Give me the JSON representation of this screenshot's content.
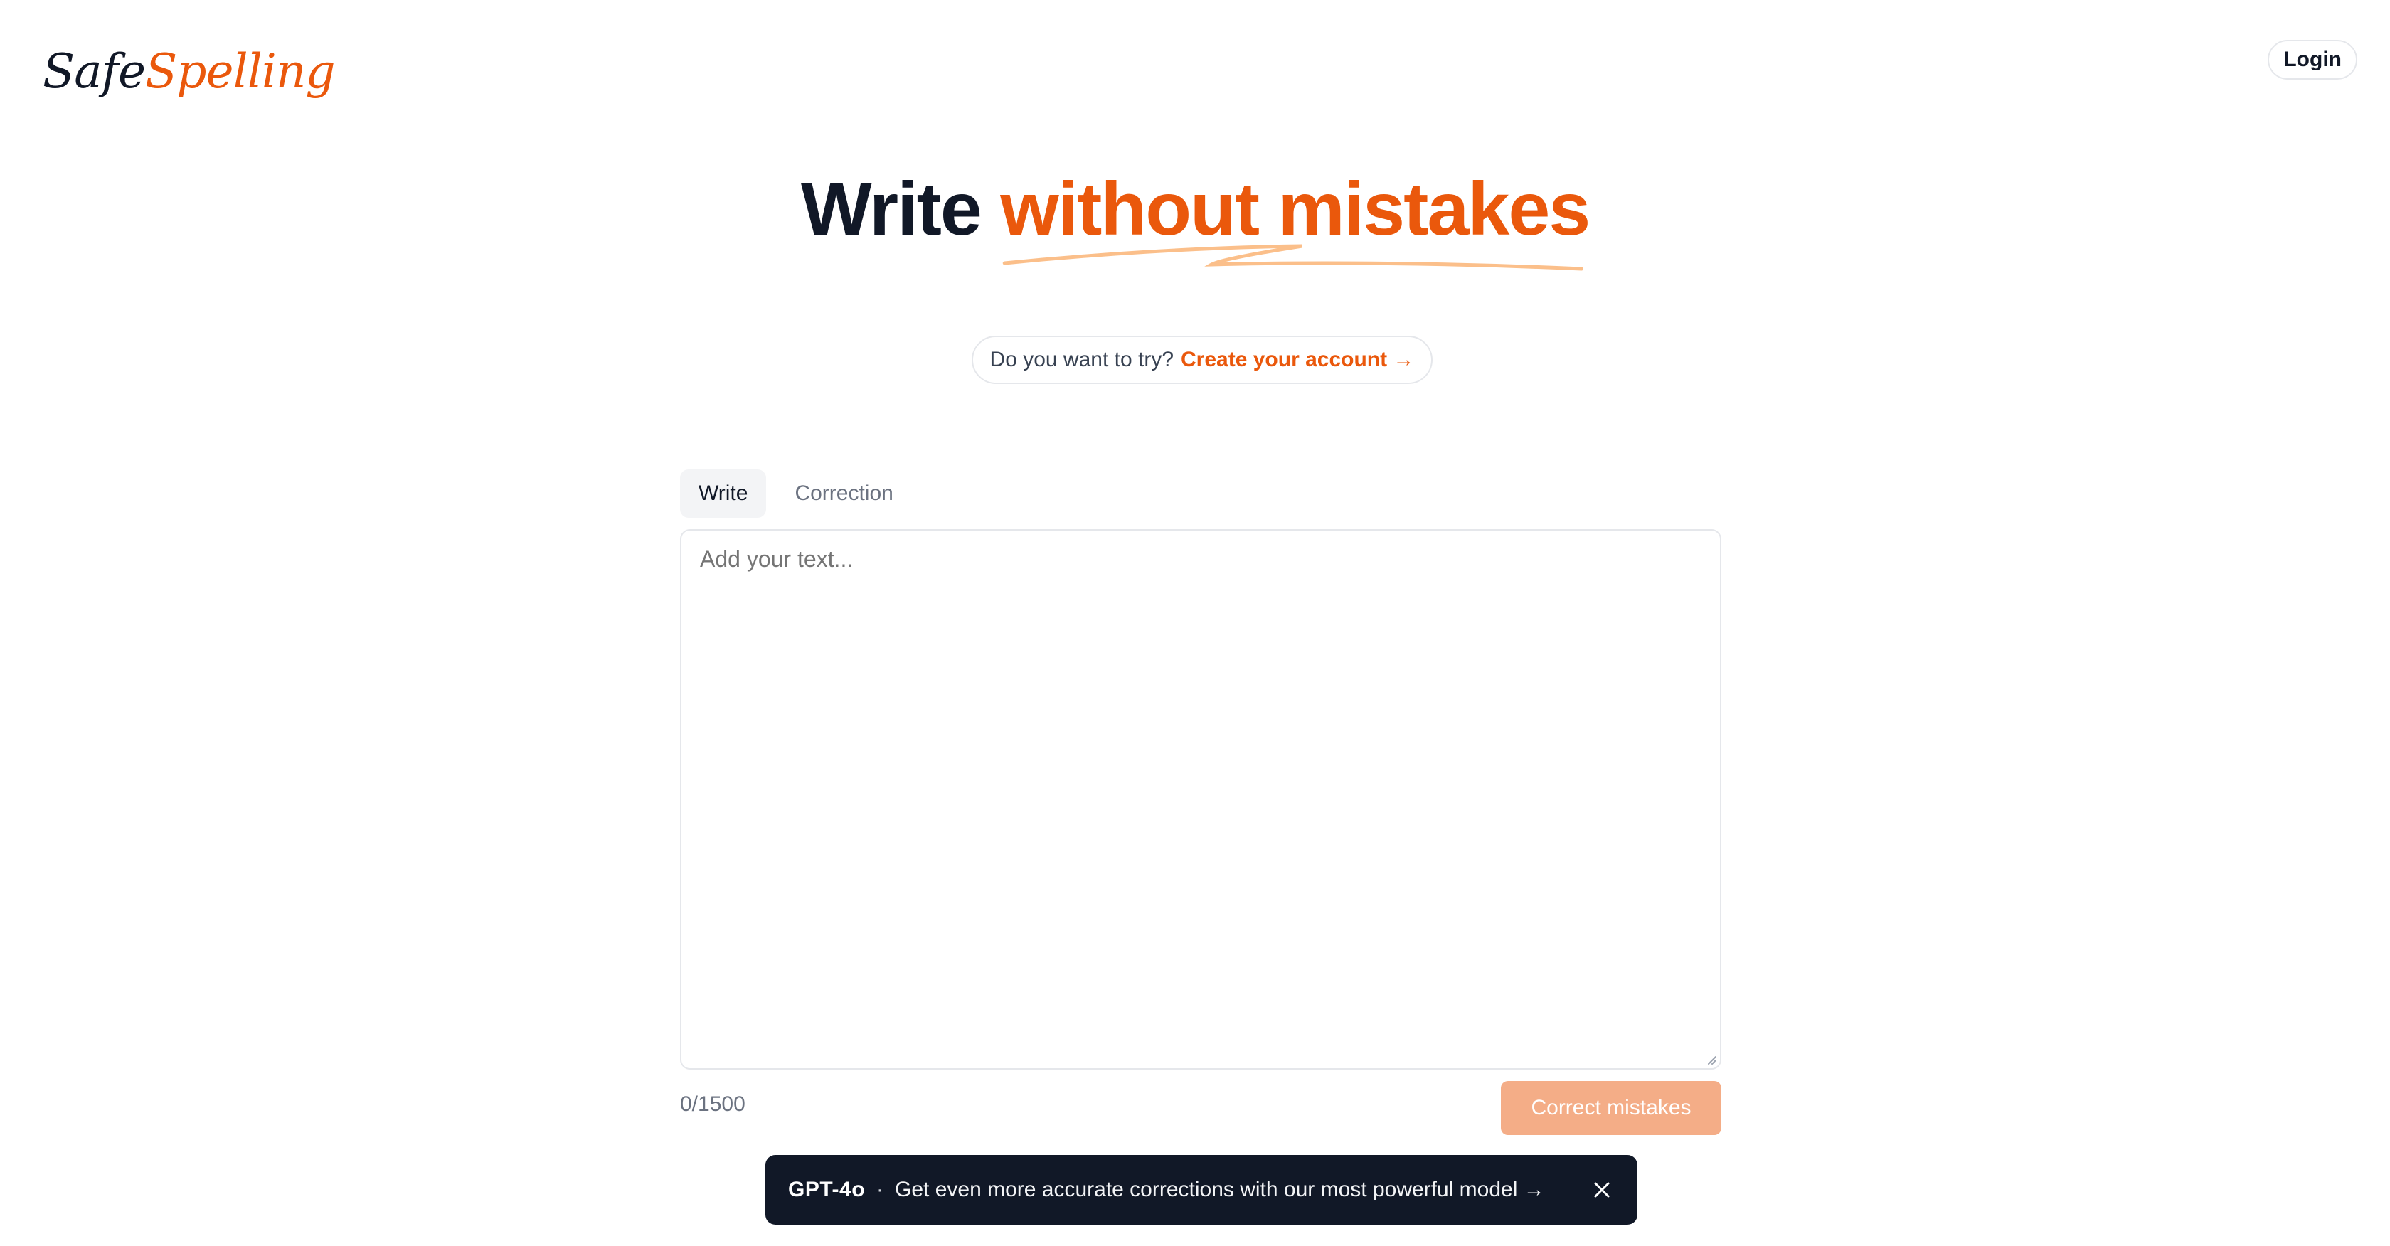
{
  "brand": {
    "logo_safe": "Safe",
    "logo_spelling": "Spelling",
    "accent_color": "#ea580c"
  },
  "header": {
    "login_label": "Login"
  },
  "hero": {
    "title_plain": "Write",
    "title_accent": "without mistakes"
  },
  "cta": {
    "prompt": "Do you want to try?",
    "link_label": "Create your account →"
  },
  "tabs": [
    {
      "label": "Write",
      "active": true
    },
    {
      "label": "Correction",
      "active": false
    }
  ],
  "editor": {
    "placeholder": "Add your text...",
    "value": "",
    "counter": "0/1500"
  },
  "actions": {
    "correct_label": "Correct mistakes"
  },
  "banner": {
    "model": "GPT-4o",
    "separator": "·",
    "message": "Get even more accurate corrections with our most powerful model →",
    "close_icon": "close-icon"
  }
}
